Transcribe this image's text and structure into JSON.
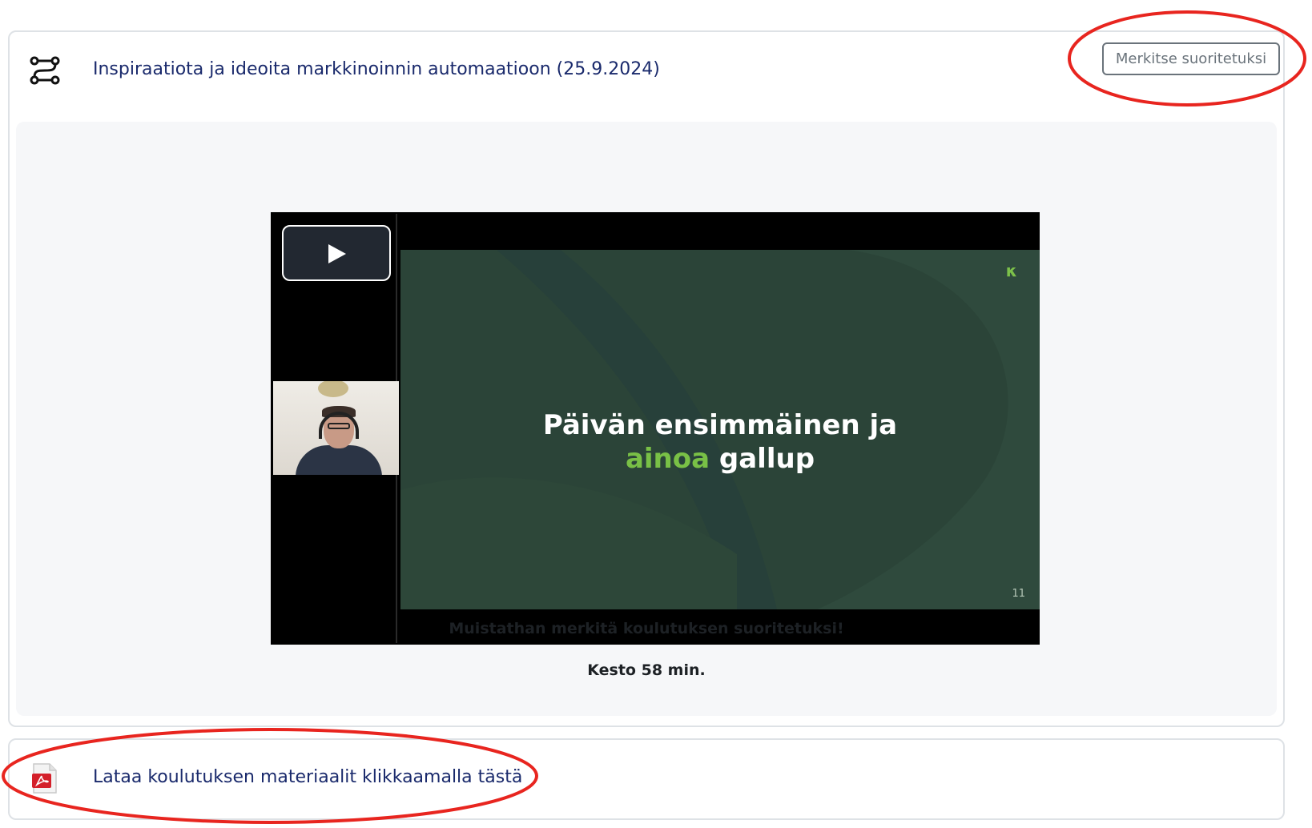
{
  "activity": {
    "icon": "workflow-icon",
    "title": "Inspiraatiota ja ideoita markkinoinnin automaatioon (25.9.2024)",
    "complete_button_label": "Merkitse suoritetuksi"
  },
  "video": {
    "play_icon": "play-icon",
    "slide": {
      "line1": "Päivän ensimmäinen ja",
      "highlight": "ainoa",
      "line2_rest": " gallup",
      "slide_number": "11",
      "logo_mark": "κ",
      "accent_color": "#79c046"
    }
  },
  "notes": {
    "reminder": "Muistathan merkitä koulutuksen suoritetuksi!",
    "duration": "Kesto 58 min."
  },
  "resource": {
    "icon": "pdf-icon",
    "link_label": "Lataa koulutuksen materiaalit klikkaamalla tästä"
  },
  "colors": {
    "link": "#1a2a6c",
    "annotation": "#e8251f",
    "card_border": "#dee2e6"
  }
}
